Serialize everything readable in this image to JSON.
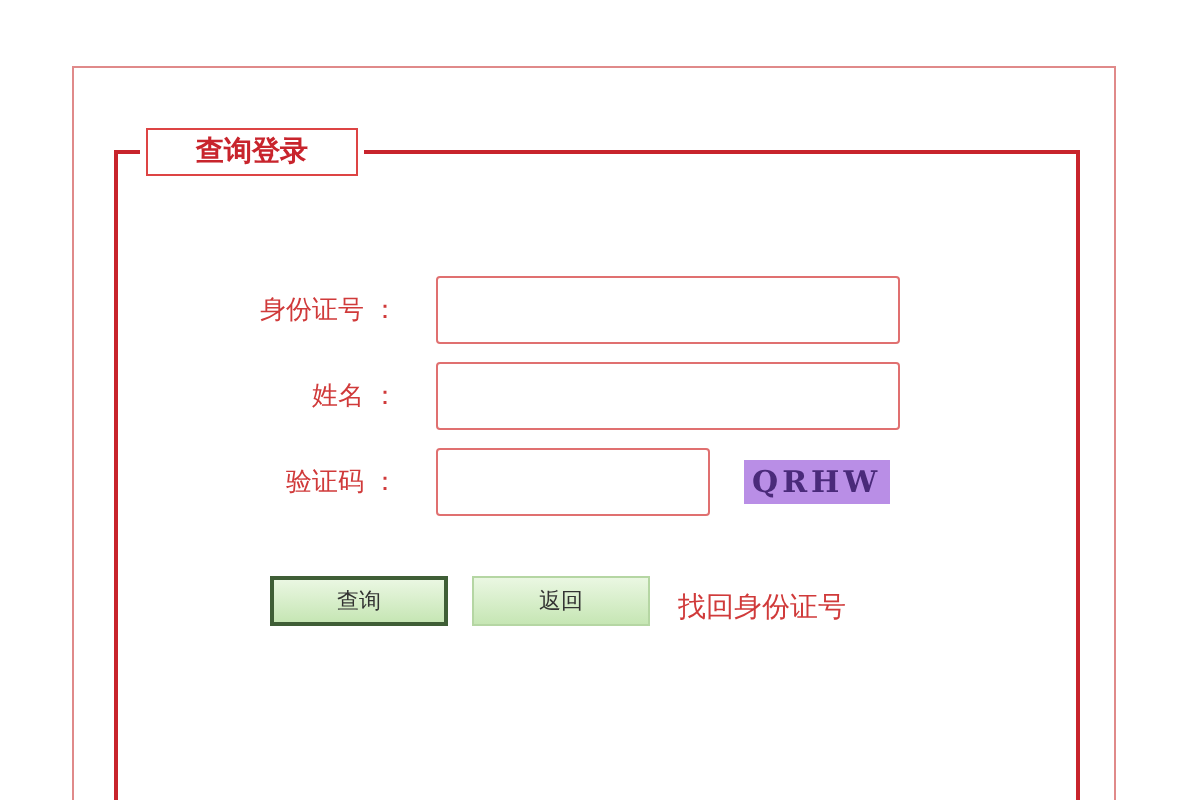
{
  "legend": "查询登录",
  "fields": [
    {
      "label": "身份证号 ：",
      "kind": "long"
    },
    {
      "label": "姓名 ：",
      "kind": "long"
    },
    {
      "label": "验证码 ：",
      "kind": "short"
    }
  ],
  "captcha": "QRHW",
  "buttons": [
    {
      "label": "查询",
      "focused": true
    },
    {
      "label": "返回",
      "focused": false
    }
  ],
  "link": "找回身份证号"
}
